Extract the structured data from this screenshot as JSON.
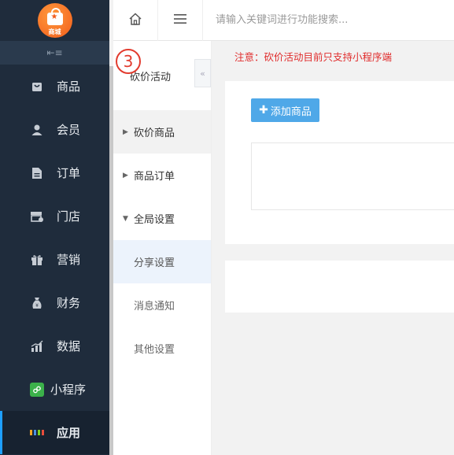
{
  "sidebar": {
    "logo_text": "商城",
    "collapse_icon": "collapse-left-icon",
    "items": [
      {
        "label": "商品",
        "icon": "goods-bag-icon"
      },
      {
        "label": "会员",
        "icon": "user-icon"
      },
      {
        "label": "订单",
        "icon": "document-icon"
      },
      {
        "label": "门店",
        "icon": "store-icon"
      },
      {
        "label": "营销",
        "icon": "gift-icon"
      },
      {
        "label": "财务",
        "icon": "money-bag-icon"
      },
      {
        "label": "数据",
        "icon": "bar-chart-icon"
      },
      {
        "label": "小程序",
        "icon": "mini-program-icon"
      },
      {
        "label": "应用",
        "icon": "apps-grid-icon",
        "active": true
      }
    ]
  },
  "topbar": {
    "search_placeholder": "请输入关键词进行功能搜索..."
  },
  "submenu": {
    "title": "砍价活动",
    "annotation_number": "3",
    "items": [
      {
        "label": "砍价商品",
        "type": "collapsed"
      },
      {
        "label": "商品订单",
        "type": "collapsed"
      },
      {
        "label": "全局设置",
        "type": "expanded"
      },
      {
        "label": "分享设置",
        "type": "leaf",
        "selected": true
      },
      {
        "label": "消息通知",
        "type": "leaf"
      },
      {
        "label": "其他设置",
        "type": "leaf"
      }
    ]
  },
  "main": {
    "notice": "注意：砍价活动目前只支持小程序端",
    "add_button": "添加商品"
  },
  "colors": {
    "sidebar_bg": "#1f2c3c",
    "accent_blue": "#4fa8e8",
    "notice_red": "#e02d2d"
  }
}
